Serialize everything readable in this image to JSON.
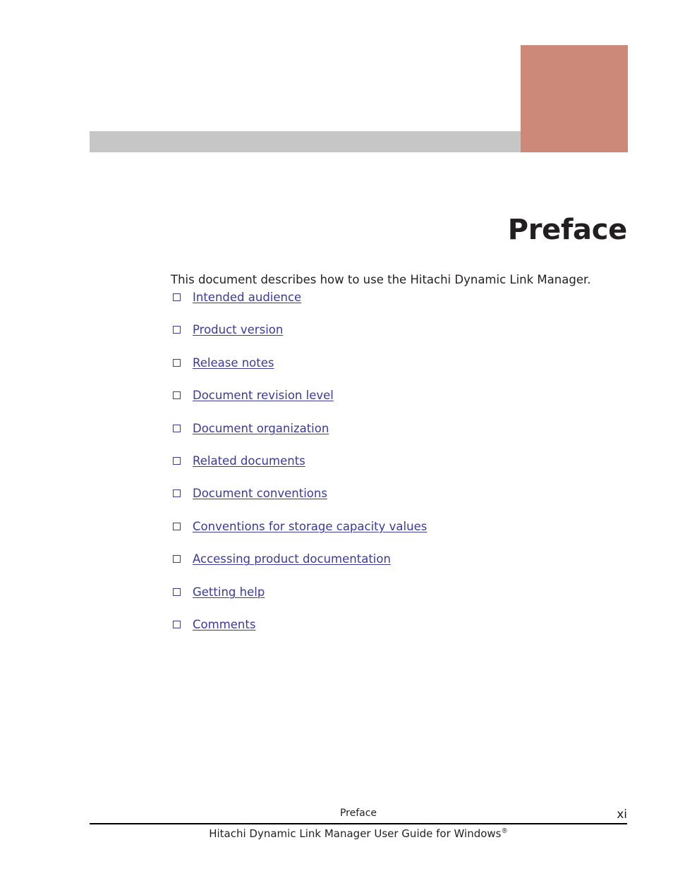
{
  "page": {
    "chapter_title": "Preface",
    "intro_paragraph": "This document describes how to use the Hitachi Dynamic Link Manager.",
    "accent_color": "#cc8878",
    "bar_color": "#c6c6c6",
    "link_color": "#3a3a9c",
    "text_color": "#231f20"
  },
  "toc": {
    "items": [
      {
        "label": "Intended audience",
        "bullet": "hollow-square-bullet-icon"
      },
      {
        "label": "Product version",
        "bullet": "hollow-square-bullet-icon"
      },
      {
        "label": "Release notes",
        "bullet": "hollow-square-bullet-icon"
      },
      {
        "label": "Document revision level",
        "bullet": "hollow-square-bullet-icon"
      },
      {
        "label": "Document organization",
        "bullet": "hollow-square-bullet-icon"
      },
      {
        "label": "Related documents",
        "bullet": "hollow-square-bullet-icon"
      },
      {
        "label": "Document conventions",
        "bullet": "hollow-square-bullet-icon"
      },
      {
        "label": "Conventions for storage capacity values",
        "bullet": "hollow-square-bullet-icon"
      },
      {
        "label": "Accessing product documentation",
        "bullet": "hollow-square-bullet-icon"
      },
      {
        "label": "Getting help",
        "bullet": "hollow-square-bullet-icon"
      },
      {
        "label": "Comments",
        "bullet": "hollow-square-bullet-icon"
      }
    ]
  },
  "footer": {
    "running_head": "Preface",
    "page_number": "xi",
    "document_title": "Hitachi Dynamic Link Manager User Guide for Windows",
    "document_title_superscript": "®"
  }
}
